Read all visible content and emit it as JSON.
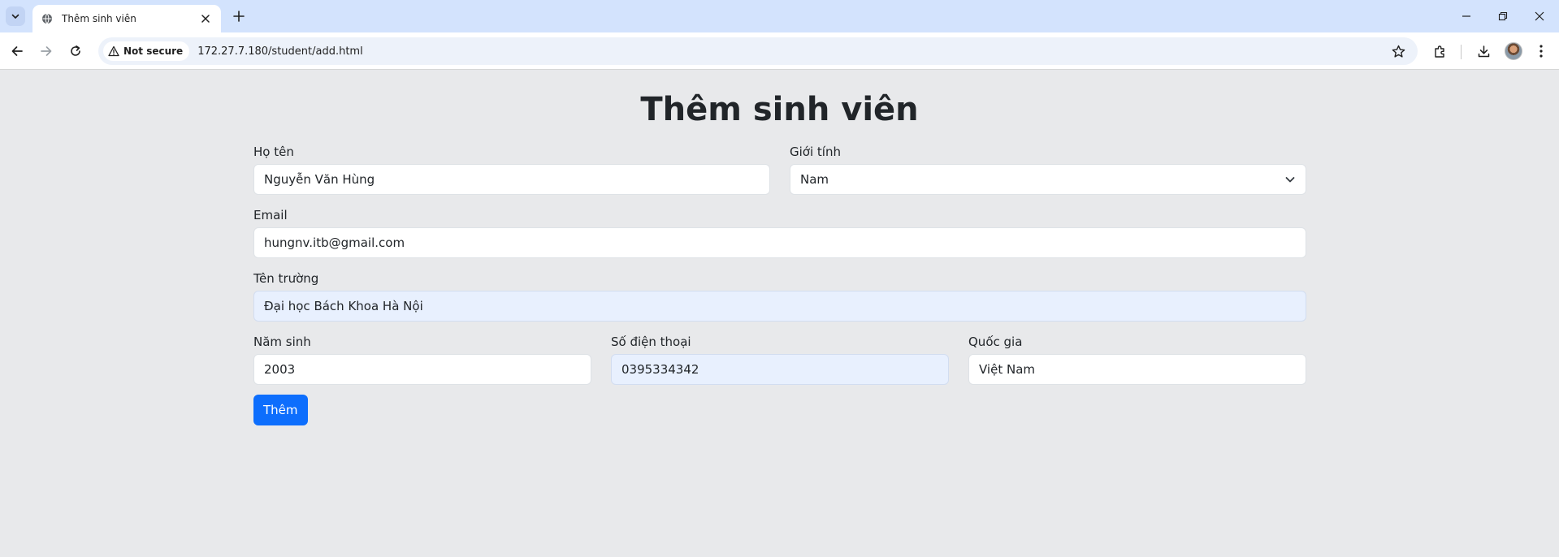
{
  "browser": {
    "tab_title": "Thêm sinh viên",
    "security_label": "Not secure",
    "url": "172.27.7.180/student/add.html"
  },
  "page": {
    "title": "Thêm sinh viên",
    "fields": {
      "ho_ten": {
        "label": "Họ tên",
        "value": "Nguyễn Văn Hùng"
      },
      "gioi_tinh": {
        "label": "Giới tính",
        "value": "Nam"
      },
      "email": {
        "label": "Email",
        "value": "hungnv.itb@gmail.com"
      },
      "ten_truong": {
        "label": "Tên trường",
        "value": "Đại học Bách Khoa Hà Nội"
      },
      "nam_sinh": {
        "label": "Năm sinh",
        "value": "2003"
      },
      "so_dien_thoai": {
        "label": "Số điện thoại",
        "value": "0395334342"
      },
      "quoc_gia": {
        "label": "Quốc gia",
        "value": "Việt Nam"
      }
    },
    "submit_label": "Thêm"
  },
  "colors": {
    "primary": "#0d6efd",
    "page_bg": "#e8e9eb",
    "autofill_bg": "#e8f0fe",
    "tabbar_bg": "#d3e3fd"
  },
  "icons": [
    "tab-search-icon",
    "globe-icon",
    "close-icon",
    "plus-icon",
    "minimize-icon",
    "restore-icon",
    "back-arrow-icon",
    "forward-arrow-icon",
    "reload-icon",
    "warning-icon",
    "star-icon",
    "extensions-icon",
    "download-icon",
    "menu-icon",
    "chevron-down-icon"
  ]
}
